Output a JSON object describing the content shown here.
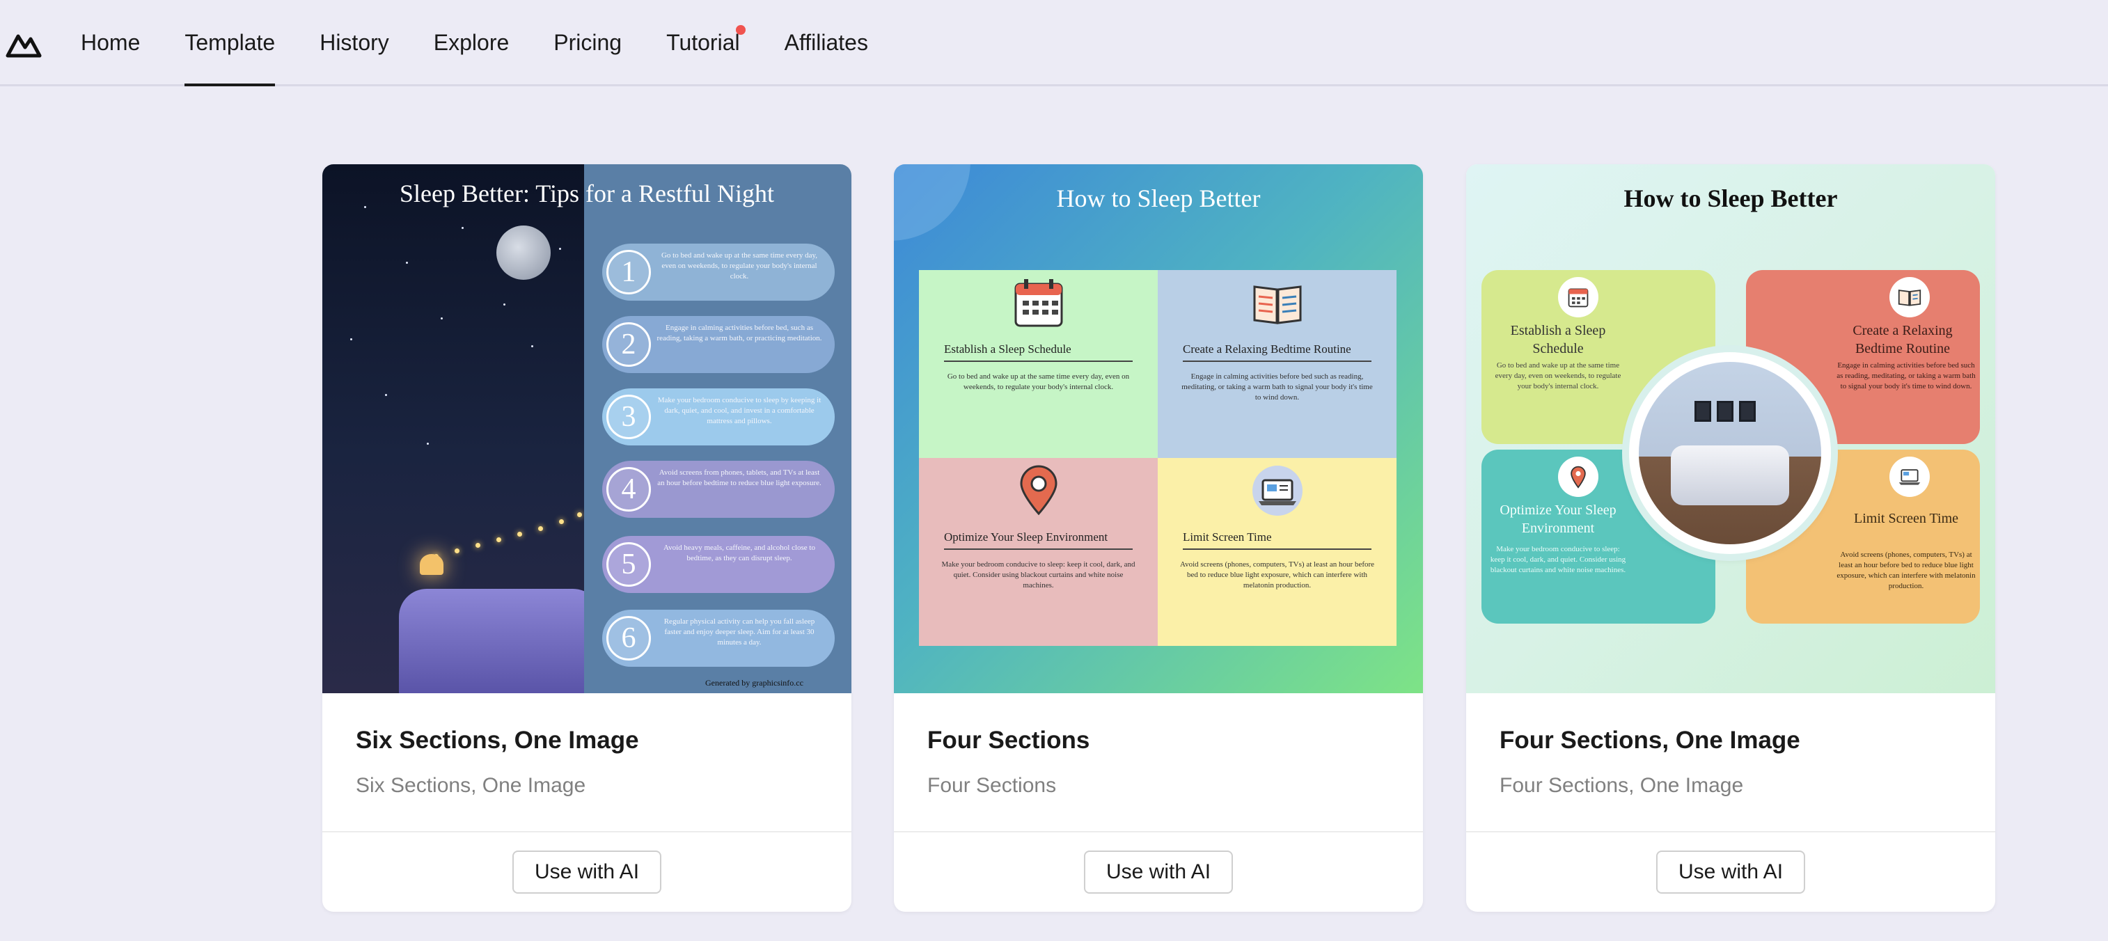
{
  "nav": {
    "items": [
      {
        "label": "Home",
        "active": false,
        "badge": false
      },
      {
        "label": "Template",
        "active": true,
        "badge": false
      },
      {
        "label": "History",
        "active": false,
        "badge": false
      },
      {
        "label": "Explore",
        "active": false,
        "badge": false
      },
      {
        "label": "Pricing",
        "active": false,
        "badge": false
      },
      {
        "label": "Tutorial",
        "active": false,
        "badge": true
      },
      {
        "label": "Affiliates",
        "active": false,
        "badge": false
      }
    ]
  },
  "colors": {
    "badge": "#f0534f",
    "page_bg": "#ecebf5"
  },
  "cards": [
    {
      "title": "Six Sections, One Image",
      "subtitle": "Six Sections, One Image",
      "button": "Use with AI",
      "preview": {
        "title": "Sleep Better: Tips for a Restful Night",
        "footer": "Generated by graphicsinfo.cc",
        "items": [
          {
            "num": "1",
            "text": "Go to bed and wake up at the same time every day, even on weekends, to regulate your body's internal clock."
          },
          {
            "num": "2",
            "text": "Engage in calming activities before bed, such as reading, taking a warm bath, or practicing meditation."
          },
          {
            "num": "3",
            "text": "Make your bedroom conducive to sleep by keeping it dark, quiet, and cool, and invest in a comfortable mattress and pillows."
          },
          {
            "num": "4",
            "text": "Avoid screens from phones, tablets, and TVs at least an hour before bedtime to reduce blue light exposure."
          },
          {
            "num": "5",
            "text": "Avoid heavy meals, caffeine, and alcohol close to bedtime, as they can disrupt sleep."
          },
          {
            "num": "6",
            "text": "Regular physical activity can help you fall asleep faster and enjoy deeper sleep. Aim for at least 30 minutes a day."
          }
        ]
      }
    },
    {
      "title": "Four Sections",
      "subtitle": "Four Sections",
      "button": "Use with AI",
      "preview": {
        "title": "How to Sleep Better",
        "sections": [
          {
            "heading": "Establish a Sleep Schedule",
            "text": "Go to bed and wake up at the same time every day, even on weekends, to regulate your body's internal clock.",
            "icon": "calendar-icon"
          },
          {
            "heading": "Create a Relaxing Bedtime Routine",
            "text": "Engage in calming activities before bed such as reading, meditating, or taking a warm bath to signal your body it's time to wind down.",
            "icon": "book-icon"
          },
          {
            "heading": "Optimize Your Sleep Environment",
            "text": "Make your bedroom conducive to sleep: keep it cool, dark, and quiet. Consider using blackout curtains and white noise machines.",
            "icon": "location-pin-icon"
          },
          {
            "heading": "Limit Screen Time",
            "text": "Avoid screens (phones, computers, TVs) at least an hour before bed to reduce blue light exposure, which can interfere with melatonin production.",
            "icon": "laptop-icon"
          }
        ]
      }
    },
    {
      "title": "Four Sections, One Image",
      "subtitle": "Four Sections, One Image",
      "button": "Use with AI",
      "preview": {
        "title": "How to Sleep Better",
        "sections": [
          {
            "heading": "Establish a Sleep Schedule",
            "text": "Go to bed and wake up at the same time every day, even on weekends, to regulate your body's internal clock.",
            "icon": "calendar-icon"
          },
          {
            "heading": "Create a Relaxing Bedtime Routine",
            "text": "Engage in calming activities before bed such as reading, meditating, or taking a warm bath to signal your body it's time to wind down.",
            "icon": "book-icon"
          },
          {
            "heading": "Optimize Your Sleep Environment",
            "text": "Make your bedroom conducive to sleep: keep it cool, dark, and quiet. Consider using blackout curtains and white noise machines.",
            "icon": "location-pin-icon"
          },
          {
            "heading": "Limit Screen Time",
            "text": "Avoid screens (phones, computers, TVs) at least an hour before bed to reduce blue light exposure, which can interfere with melatonin production.",
            "icon": "laptop-icon"
          }
        ]
      }
    }
  ]
}
